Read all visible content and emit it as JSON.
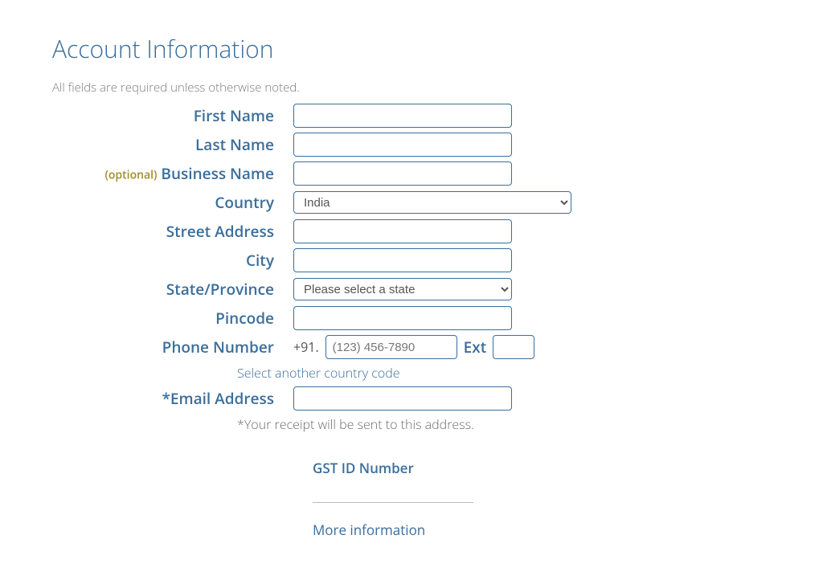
{
  "header": {
    "title": "Account Information",
    "required_note": "All fields are required unless otherwise noted."
  },
  "form": {
    "optional_tag": "(optional)",
    "first_name_label": "First Name",
    "last_name_label": "Last Name",
    "business_name_label": "Business Name",
    "country_label": "Country",
    "country_value": "India",
    "street_label": "Street Address",
    "city_label": "City",
    "state_label": "State/Province",
    "state_value": "Please select a state",
    "pincode_label": "Pincode",
    "phone_label": "Phone Number",
    "phone_prefix": "+91.",
    "phone_placeholder": "(123) 456-7890",
    "ext_label": "Ext",
    "select_country_code": "Select another country code",
    "email_label": "*Email Address",
    "email_note": "*Your receipt will be sent to this address.",
    "gst_label": "GST ID Number",
    "more_info": "More information"
  }
}
